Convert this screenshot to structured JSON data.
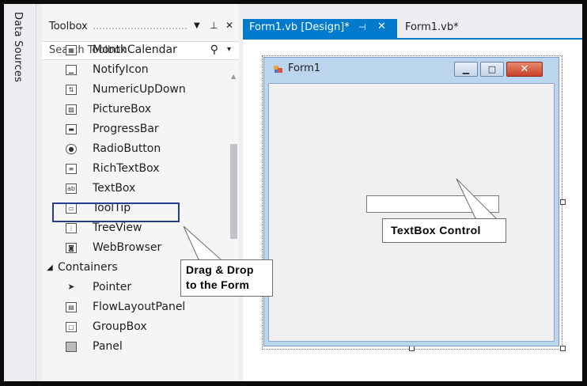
{
  "side_strip": {
    "label": "Data Sources"
  },
  "toolbox": {
    "title": "Toolbox",
    "dropdown_glyph": "▼",
    "pin_glyph": "⊥",
    "close_glyph": "✕",
    "search": {
      "placeholder": "Search Toolbox",
      "icon": "search-icon"
    },
    "items": [
      {
        "label": "MonthCalendar",
        "icon": "calendar-icon"
      },
      {
        "label": "NotifyIcon",
        "icon": "notify-icon"
      },
      {
        "label": "NumericUpDown",
        "icon": "numeric-icon"
      },
      {
        "label": "PictureBox",
        "icon": "picture-icon"
      },
      {
        "label": "ProgressBar",
        "icon": "progress-icon"
      },
      {
        "label": "RadioButton",
        "icon": "radio-icon"
      },
      {
        "label": "RichTextBox",
        "icon": "richtext-icon"
      },
      {
        "label": "TextBox",
        "icon": "textbox-icon",
        "highlighted": true
      },
      {
        "label": "ToolTip",
        "icon": "tooltip-icon"
      },
      {
        "label": "TreeView",
        "icon": "tree-icon"
      },
      {
        "label": "WebBrowser",
        "icon": "browser-icon"
      }
    ],
    "group": {
      "label": "Containers",
      "expanded": true
    },
    "group_items": [
      {
        "label": "Pointer",
        "icon": "pointer-icon"
      },
      {
        "label": "FlowLayoutPanel",
        "icon": "flowlayout-icon"
      },
      {
        "label": "GroupBox",
        "icon": "groupbox-icon"
      },
      {
        "label": "Panel",
        "icon": "panel-icon"
      }
    ]
  },
  "tabs": [
    {
      "label": "Form1.vb [Design]*",
      "active": true
    },
    {
      "label": "Form1.vb*",
      "active": false
    }
  ],
  "form": {
    "caption": "Form1"
  },
  "callouts": {
    "textbox_control": "TextBox Control",
    "drag_drop": "Drag & Drop\nto the Form"
  },
  "colors": {
    "accent": "#007acc",
    "highlight_border": "#283c94",
    "form_frame": "#bcd5ee"
  }
}
